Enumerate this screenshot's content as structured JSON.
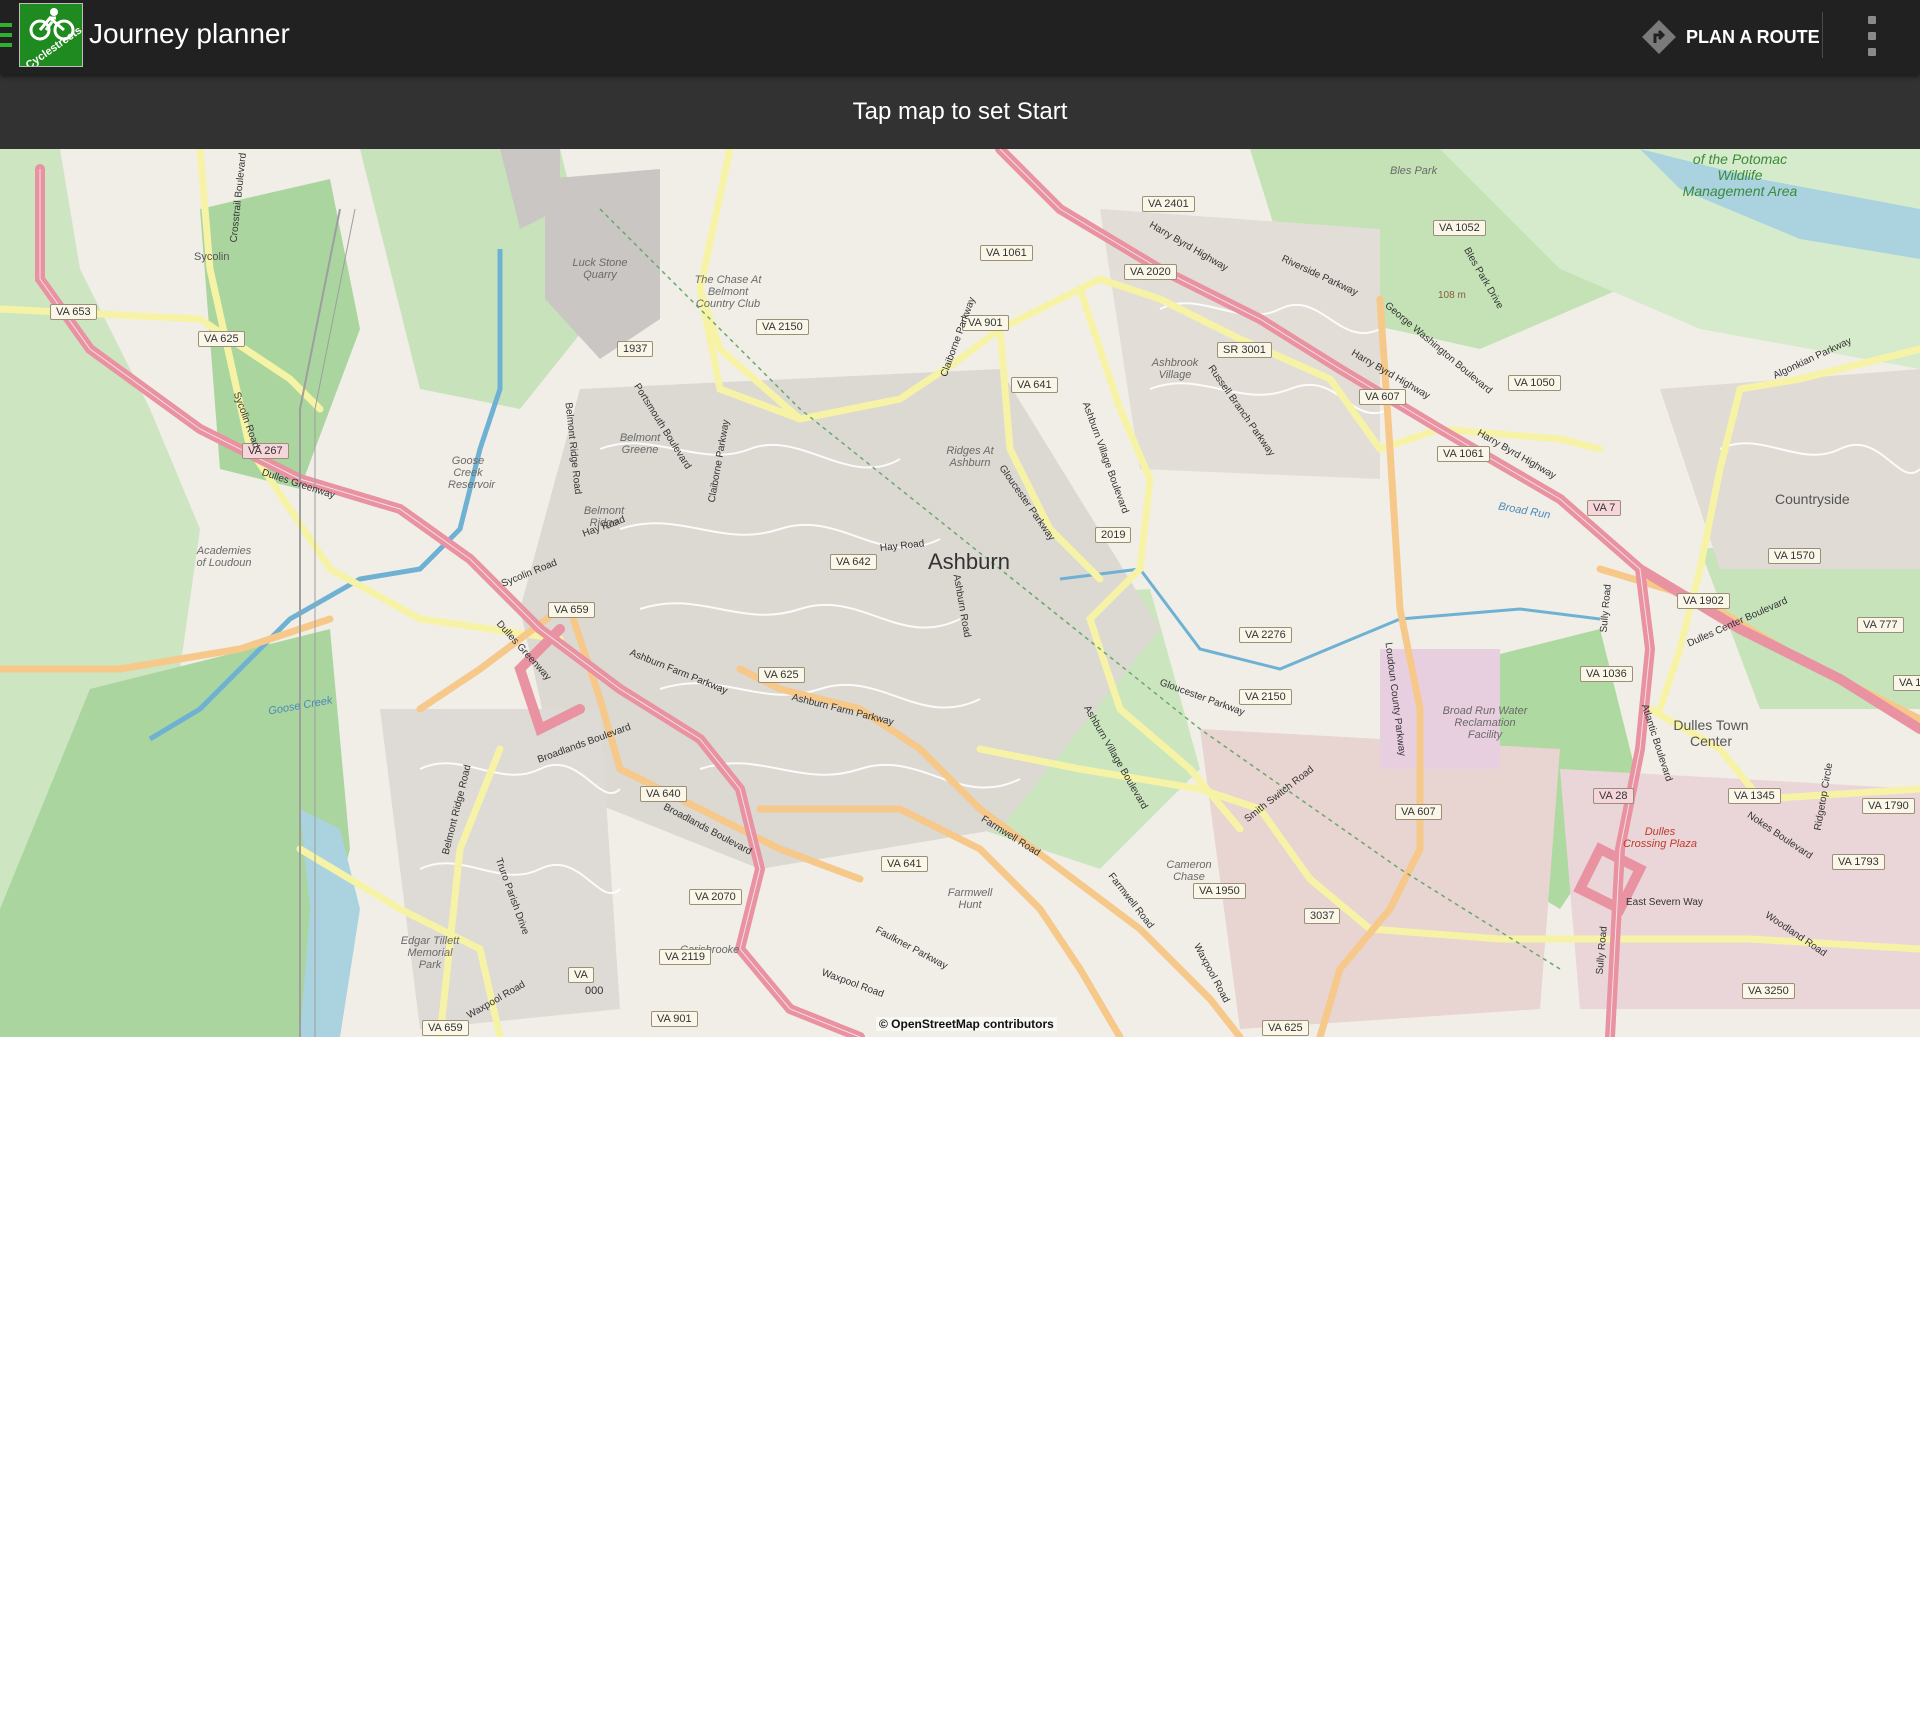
{
  "app": {
    "title": "Journey planner",
    "logo_text": "Cyclestreets",
    "plan_route_label": "PLAN A ROUTE",
    "hint": "Tap map to set Start"
  },
  "icons": {
    "drawer": "menu-drawer-icon",
    "plan": "route-diamond-icon",
    "overflow": "more-vert-icon",
    "undo": "undo-arrow-icon",
    "locate": "crosshair-locate-icon"
  },
  "colors": {
    "actionbar": "#212121",
    "hintbar": "#323232",
    "accent_green": "#2fb02f",
    "map_background": "#f1eee8"
  },
  "map": {
    "attribution": "© OpenStreetMap contributors",
    "places": {
      "ashburn": "Ashburn",
      "countryside": "Countryside",
      "dulles_town_center": "Dulles Town Center",
      "potomac": "of the Potomac Wildlife Management Area",
      "luck_stone": "Luck Stone Quarry",
      "sycolin": "Sycolin",
      "chase_belmont": "The Chase At Belmont Country Club",
      "belmont_greene": "Belmont Greene",
      "belmont_ridge": "Belmont Ridge",
      "ridges_ashburn": "Ridges At Ashburn",
      "ashbrook": "Ashbrook Village",
      "goose_reservoir": "Goose Creek Reservoir",
      "academies": "Academies of Loudoun",
      "broad_run_facility": "Broad Run Water Reclamation Facility",
      "cameron_chase": "Cameron Chase",
      "farmwell_hunt": "Farmwell Hunt",
      "carisbrooke": "Carisbrooke",
      "edgar_tillett": "Edgar Tillett Memorial Park",
      "dulles_crossing": "Dulles Crossing Plaza",
      "bles_park": "Bles Park",
      "elevation": "108 m",
      "goose_creek": "Goose Creek",
      "broad_run": "Broad Run"
    },
    "shields": {
      "va653": "VA 653",
      "va625a": "VA 625",
      "va267": "VA 267",
      "va659a": "VA 659",
      "r1937": "1937",
      "va2150a": "VA 2150",
      "va901a": "VA 901",
      "va1061a": "VA 1061",
      "va641a": "VA 641",
      "va2401": "VA 2401",
      "va2020": "VA 2020",
      "sr3001": "SR 3001",
      "va607a": "VA 607",
      "va1052": "VA 1052",
      "va1050": "VA 1050",
      "va1061b": "VA 1061",
      "va7": "VA 7",
      "va1570": "VA 1570",
      "va1902": "VA 1902",
      "va777": "VA 777",
      "va1036": "VA 1036",
      "r2019": "2019",
      "va642": "VA 642",
      "va2276": "VA 2276",
      "va2150b": "VA 2150",
      "va625b": "VA 625",
      "va640": "VA 640",
      "va2070": "VA 2070",
      "va2119": "VA 2119",
      "va901b": "VA 901",
      "va641b": "VA 641",
      "va1950": "VA 1950",
      "r3037": "3037",
      "va607b": "VA 607",
      "va28": "VA 28",
      "va1345": "VA 1345",
      "va1790": "VA 1790",
      "va1793": "VA 1793",
      "va3250": "VA 3250",
      "va625c": "VA 625",
      "va659b": "VA 659",
      "va_cut": "VA",
      "r000": "000",
      "va1_cut": "VA 1"
    },
    "roads": {
      "dulles_greenway": "Dulles Greenway",
      "harry_byrd": "Harry Byrd Highway",
      "riverside": "Riverside Parkway",
      "gw_blvd": "George Washington Boulevard",
      "russell_branch": "Russell Branch Parkway",
      "claiborne": "Claiborne Parkway",
      "gloucester": "Gloucester Parkway",
      "ashburn_village": "Ashburn Village Boulevard",
      "ashburn_road": "Ashburn Road",
      "hay_road": "Hay Road",
      "ashburn_farm": "Ashburn Farm Parkway",
      "farmwell": "Farmwell Road",
      "loudoun_county": "Loudoun County Parkway",
      "smith_switch": "Smith Switch Road",
      "sully": "Sully Road",
      "waxpool": "Waxpool Road",
      "broadlands": "Broadlands Boulevard",
      "sycolin_road": "Sycolin Road",
      "belmont_ridge_road": "Belmont Ridge Road",
      "faulkner": "Faulkner Parkway",
      "nokes": "Nokes Boulevard",
      "atlantic": "Atlantic Boulevard",
      "dulles_center": "Dulles Center Boulevard",
      "algonkian": "Algonkian Parkway",
      "east_severn": "East Severn Way",
      "woodland": "Woodland Road",
      "ridgetop": "Ridgetop Circle",
      "portsmouth": "Portsmouth Boulevard",
      "truro_parish": "Truro Parish Drive",
      "crosstrail": "Crosstrail Boulevard",
      "bles_park_drive": "Bles Park Drive"
    }
  }
}
